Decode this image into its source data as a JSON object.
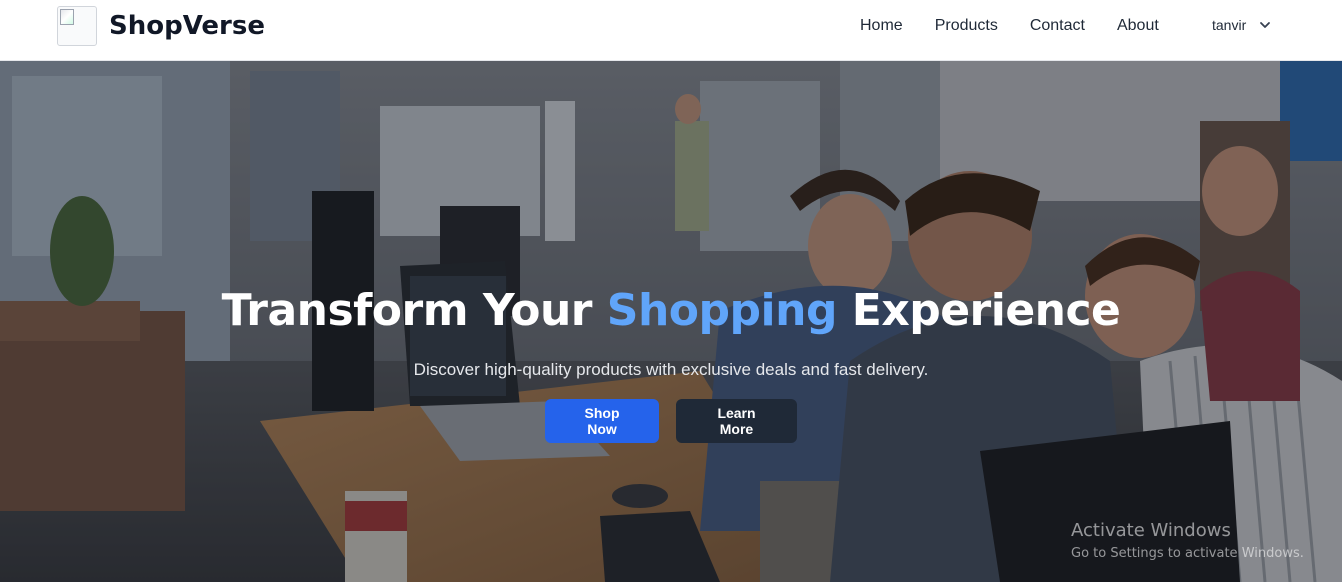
{
  "navbar": {
    "brand": "ShopVerse",
    "links": [
      "Home",
      "Products",
      "Contact",
      "About"
    ],
    "user": "tanvir"
  },
  "hero": {
    "title_prefix": "Transform Your ",
    "title_accent": "Shopping",
    "title_suffix": " Experience",
    "subtitle": "Discover high-quality products with exclusive deals and fast delivery.",
    "primary_button": "Shop Now",
    "secondary_button": "Learn More"
  },
  "watermark": {
    "title": "Activate Windows",
    "subtitle": "Go to Settings to activate Windows."
  },
  "colors": {
    "accent": "#60a5fa",
    "primary_button": "#2563eb",
    "secondary_button": "#1f2937",
    "brand_text": "#111827"
  },
  "icons": {
    "logo": "broken-image-icon",
    "user_dropdown": "chevron-down-icon"
  }
}
